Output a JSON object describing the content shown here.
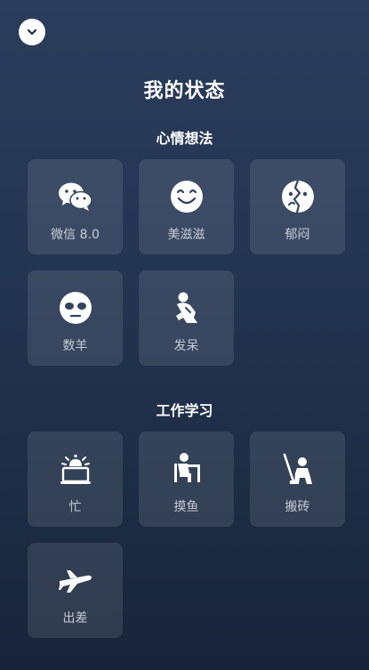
{
  "page_title": "我的状态",
  "sections": [
    {
      "title": "心情想法",
      "items": [
        {
          "label": "微信 8.0",
          "icon": "wechat-icon"
        },
        {
          "label": "美滋滋",
          "icon": "smile-face-icon"
        },
        {
          "label": "郁闷",
          "icon": "cracked-face-icon"
        },
        {
          "label": "数羊",
          "icon": "sheep-face-icon"
        },
        {
          "label": "发呆",
          "icon": "daze-figure-icon"
        }
      ]
    },
    {
      "title": "工作学习",
      "items": [
        {
          "label": "忙",
          "icon": "alarm-laptop-icon"
        },
        {
          "label": "摸鱼",
          "icon": "person-desk-icon"
        },
        {
          "label": "搬砖",
          "icon": "worker-shovel-icon"
        },
        {
          "label": "出差",
          "icon": "airplane-icon"
        }
      ]
    }
  ],
  "colors": {
    "background_top": "#2a3d5c",
    "background_bottom": "#18243a",
    "tile_background": "rgba(255,255,255,0.10)",
    "icon": "#ffffff"
  }
}
